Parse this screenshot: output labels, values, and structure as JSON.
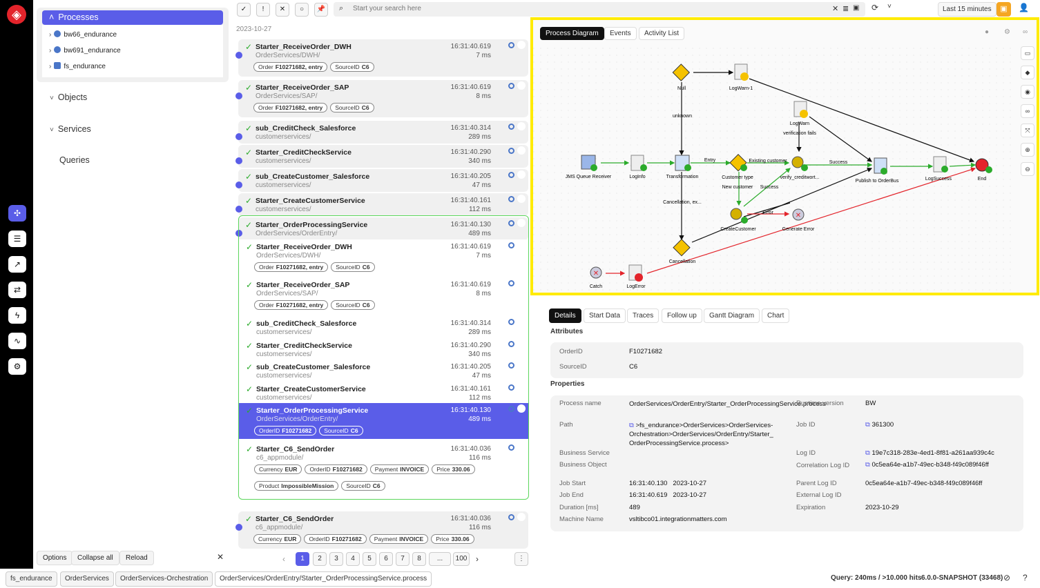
{
  "rail": {
    "icons": [
      "apps-icon",
      "list-icon",
      "chart-icon",
      "swap-icon",
      "bolt-icon",
      "pulse-icon",
      "gear-icon"
    ]
  },
  "tree": {
    "title": "Processes",
    "items": [
      "bw66_endurance",
      "bw691_endurance",
      "fs_endurance"
    ],
    "sections": [
      "Objects",
      "Services",
      "Queries"
    ]
  },
  "bottom": {
    "options": "Options",
    "collapse": "Collapse all",
    "reload": "Reload"
  },
  "toolbar": {
    "search_placeholder": "Start your search here",
    "time_range": "Last 15 minutes"
  },
  "list": {
    "date": "2023-10-27",
    "items": [
      {
        "name": "Starter_ReceiveOrder_DWH",
        "path": "OrderServices/DWH/",
        "time": "16:31:40.619",
        "dur": "7 ms",
        "chips": [
          [
            "Order",
            "F10271682, entry"
          ],
          [
            "SourceID",
            "C6"
          ]
        ]
      },
      {
        "name": "Starter_ReceiveOrder_SAP",
        "path": "OrderServices/SAP/",
        "time": "16:31:40.619",
        "dur": "8 ms",
        "chips": [
          [
            "Order",
            "F10271682, entry"
          ],
          [
            "SourceID",
            "C6"
          ]
        ]
      },
      {
        "name": "sub_CreditCheck_Salesforce",
        "path": "customerservices/",
        "time": "16:31:40.314",
        "dur": "289 ms"
      },
      {
        "name": "Starter_CreditCheckService",
        "path": "customerservices/",
        "time": "16:31:40.290",
        "dur": "340 ms"
      },
      {
        "name": "sub_CreateCustomer_Salesforce",
        "path": "customerservices/",
        "time": "16:31:40.205",
        "dur": "47 ms"
      },
      {
        "name": "Starter_CreateCustomerService",
        "path": "customerservices/",
        "time": "16:31:40.161",
        "dur": "112 ms"
      },
      {
        "name": "Starter_OrderProcessingService",
        "path": "OrderServices/OrderEntry/",
        "time": "16:31:40.130",
        "dur": "489 ms"
      }
    ],
    "children": [
      {
        "name": "Starter_ReceiveOrder_DWH",
        "path": "OrderServices/DWH/",
        "time": "16:31:40.619",
        "dur": "7 ms",
        "chips": [
          [
            "Order",
            "F10271682, entry"
          ],
          [
            "SourceID",
            "C6"
          ]
        ]
      },
      {
        "name": "Starter_ReceiveOrder_SAP",
        "path": "OrderServices/SAP/",
        "time": "16:31:40.619",
        "dur": "8 ms",
        "chips": [
          [
            "Order",
            "F10271682, entry"
          ],
          [
            "SourceID",
            "C6"
          ]
        ]
      },
      {
        "name": "sub_CreditCheck_Salesforce",
        "path": "customerservices/",
        "time": "16:31:40.314",
        "dur": "289 ms"
      },
      {
        "name": "Starter_CreditCheckService",
        "path": "customerservices/",
        "time": "16:31:40.290",
        "dur": "340 ms"
      },
      {
        "name": "sub_CreateCustomer_Salesforce",
        "path": "customerservices/",
        "time": "16:31:40.205",
        "dur": "47 ms"
      },
      {
        "name": "Starter_CreateCustomerService",
        "path": "customerservices/",
        "time": "16:31:40.161",
        "dur": "112 ms"
      },
      {
        "name": "Starter_OrderProcessingService",
        "path": "OrderServices/OrderEntry/",
        "time": "16:31:40.130",
        "dur": "489 ms",
        "chips": [
          [
            "OrderID",
            "F10271682"
          ],
          [
            "SourceID",
            "C6"
          ]
        ]
      },
      {
        "name": "Starter_C6_SendOrder",
        "path": "c6_appmodule/",
        "time": "16:31:40.036",
        "dur": "116 ms",
        "chips": [
          [
            "Currency",
            "EUR"
          ],
          [
            "OrderID",
            "F10271682"
          ],
          [
            "Payment",
            "INVOICE"
          ],
          [
            "Price",
            "330.06"
          ]
        ],
        "chips2": [
          [
            "Product",
            "ImpossibleMission"
          ],
          [
            "SourceID",
            "C6"
          ]
        ]
      }
    ],
    "last": {
      "name": "Starter_C6_SendOrder",
      "path": "c6_appmodule/",
      "time": "16:31:40.036",
      "dur": "116 ms",
      "chips": [
        [
          "Currency",
          "EUR"
        ],
        [
          "OrderID",
          "F10271682"
        ],
        [
          "Payment",
          "INVOICE"
        ],
        [
          "Price",
          "330.06"
        ]
      ]
    }
  },
  "pager": {
    "pages": [
      "1",
      "2",
      "3",
      "4",
      "5",
      "6",
      "7",
      "8",
      "...",
      "100"
    ]
  },
  "diagram": {
    "tabs": [
      "Process Diagram",
      "Events",
      "Activity List"
    ],
    "nodes": {
      "null": "Null",
      "logwarn1": "LogWarn-1",
      "logwarn": "LogWarn",
      "verif": "verification fails",
      "unknown": "unknown",
      "jms": "JMS Queue Receiver",
      "loginfo": "LogInfo",
      "transform": "Transformation",
      "entry": "Entry",
      "ctype": "Customer type",
      "existing": "Existing customer",
      "verify": "verify_creditwort...",
      "success1": "Success",
      "publish": "Publish to OrderBus",
      "logsuccess": "LogSuccess",
      "end": "End",
      "newcust": "New customer",
      "success2": "Success",
      "cancelex": "Cancellation, ex...",
      "error": "Error",
      "createcust": "CreateCustomer",
      "generr": "Generate Error",
      "cancellation": "Cancellation",
      "catch": "Catch",
      "logerror": "LogError"
    }
  },
  "details": {
    "tabs": [
      "Details",
      "Start Data",
      "Traces",
      "Follow up",
      "Gantt Diagram",
      "Chart"
    ],
    "attributes_title": "Attributes",
    "attributes": [
      [
        "OrderID",
        "F10271682"
      ],
      [
        "SourceID",
        "C6"
      ]
    ],
    "properties_title": "Properties",
    "left": [
      [
        "Process name",
        "OrderServices/OrderEntry/Starter_OrderProcessingService.process"
      ],
      [
        "Path",
        ">fs_endurance>OrderServices>OrderServices-Orchestration>OrderServices/OrderEntry/Starter_OrderProcessingService.process>"
      ],
      [
        "Business Service",
        ""
      ],
      [
        "Business Object",
        ""
      ],
      [
        "Job Start",
        "16:31:40.130   2023-10-27"
      ],
      [
        "Job End",
        "16:31:40.619   2023-10-27"
      ],
      [
        "Duration [ms]",
        "489"
      ],
      [
        "Machine Name",
        "vsltibco01.integrationmatters.com"
      ]
    ],
    "right": [
      [
        "Runtime version",
        "BW"
      ],
      [
        "Job ID",
        "361300"
      ],
      [
        "Log ID",
        "19e7c318-283e-4ed1-8f81-a261aa939c4c"
      ],
      [
        "Correlation Log ID",
        "0c5ea64e-a1b7-49ec-b348-f49c089f46ff"
      ],
      [
        "Parent Log ID",
        "0c5ea64e-a1b7-49ec-b348-f49c089f46ff"
      ],
      [
        "External Log ID",
        ""
      ],
      [
        "Expiration",
        "2023-10-29"
      ]
    ]
  },
  "status": {
    "crumbs": [
      "fs_endurance",
      "OrderServices",
      "OrderServices-Orchestration",
      "OrderServices/OrderEntry/Starter_OrderProcessingService.process"
    ],
    "query": "Query: 240ms / >10.000 hits",
    "version": "6.0.0-SNAPSHOT (33468)"
  }
}
